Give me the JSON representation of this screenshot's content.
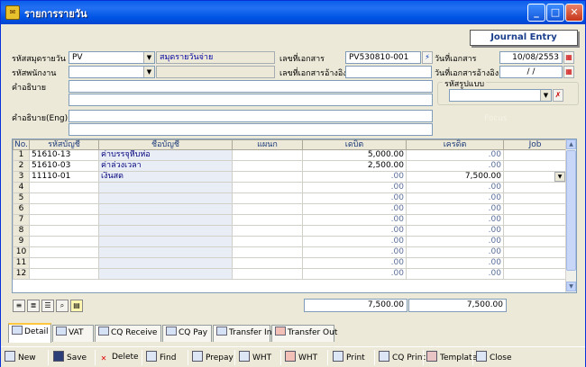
{
  "window": {
    "title": "รายการรายวัน",
    "icon": "app-icon"
  },
  "header": {
    "journal_entry": "Journal Entry",
    "journal_code_label": "รหัสสมุดรายวัน",
    "journal_code_value": "PV",
    "journal_name_value": "สมุดรายวันจ่าย",
    "doc_no_label": "เลขที่เอกสาร",
    "doc_no_value": "PV530810-001",
    "doc_date_label": "วันที่เอกสาร",
    "doc_date_value": "10/08/2553",
    "employee_label": "รหัสพนักงาน",
    "ref_doc_label": "เลขที่เอกสารอ้างอิง",
    "ref_date_label": "วันที่เอกสารอ้างอิง",
    "ref_date_value": " / /",
    "desc_label": "คำอธิบาย",
    "desc_eng_label": "คำอธิบาย(Eng)",
    "form_code_label": "รหัสรูปแบบ",
    "ghost_text": "Focus"
  },
  "grid": {
    "columns": [
      "No.",
      "รหัสบัญชี",
      "ชื่อบัญชี",
      "แผนก",
      "เดบิต",
      "เครดิต",
      "Job"
    ],
    "rows": [
      {
        "no": "1",
        "code": "51610-13",
        "name": "ค่าบรรจุหีบห่อ",
        "dept": "",
        "debit": "5,000.00",
        "credit": ".00",
        "job": ""
      },
      {
        "no": "2",
        "code": "51610-03",
        "name": "ค่าล่วงเวลา",
        "dept": "",
        "debit": "2,500.00",
        "credit": ".00",
        "job": ""
      },
      {
        "no": "3",
        "code": "11110-01",
        "name": "เงินสด",
        "dept": "",
        "debit": ".00",
        "credit": "7,500.00",
        "job": ""
      },
      {
        "no": "4",
        "code": "",
        "name": "",
        "dept": "",
        "debit": ".00",
        "credit": ".00",
        "job": ""
      },
      {
        "no": "5",
        "code": "",
        "name": "",
        "dept": "",
        "debit": ".00",
        "credit": ".00",
        "job": ""
      },
      {
        "no": "6",
        "code": "",
        "name": "",
        "dept": "",
        "debit": ".00",
        "credit": ".00",
        "job": ""
      },
      {
        "no": "7",
        "code": "",
        "name": "",
        "dept": "",
        "debit": ".00",
        "credit": ".00",
        "job": ""
      },
      {
        "no": "8",
        "code": "",
        "name": "",
        "dept": "",
        "debit": ".00",
        "credit": ".00",
        "job": ""
      },
      {
        "no": "9",
        "code": "",
        "name": "",
        "dept": "",
        "debit": ".00",
        "credit": ".00",
        "job": ""
      },
      {
        "no": "10",
        "code": "",
        "name": "",
        "dept": "",
        "debit": ".00",
        "credit": ".00",
        "job": ""
      },
      {
        "no": "11",
        "code": "",
        "name": "",
        "dept": "",
        "debit": ".00",
        "credit": ".00",
        "job": ""
      },
      {
        "no": "12",
        "code": "",
        "name": "",
        "dept": "",
        "debit": ".00",
        "credit": ".00",
        "job": ""
      }
    ]
  },
  "totals": {
    "debit": "7,500.00",
    "credit": "7,500.00"
  },
  "tabs": [
    {
      "label": "Detail",
      "icon": "detail-icon"
    },
    {
      "label": "VAT",
      "icon": "vat-icon"
    },
    {
      "label": "CQ Receive",
      "icon": "cq-receive-icon"
    },
    {
      "label": "CQ Pay",
      "icon": "cq-pay-icon"
    },
    {
      "label": "Transfer In",
      "icon": "transfer-in-icon"
    },
    {
      "label": "Transfer Out",
      "icon": "transfer-out-icon"
    }
  ],
  "toolbar": [
    {
      "label": "New",
      "icon": "new-icon"
    },
    {
      "label": "Save",
      "icon": "save-icon"
    },
    {
      "label": "Delete",
      "icon": "delete-icon"
    },
    {
      "label": "Find",
      "icon": "find-icon"
    },
    {
      "label": "Prepay",
      "icon": "prepay-icon"
    },
    {
      "label": "WHT",
      "icon": "wht-icon"
    },
    {
      "label": "WHT",
      "icon": "wht-icon"
    },
    {
      "label": "Print",
      "icon": "print-icon"
    },
    {
      "label": "CQ Print",
      "icon": "cq-print-icon"
    },
    {
      "label": "Template",
      "icon": "template-icon"
    },
    {
      "label": "Close",
      "icon": "close-door-icon"
    }
  ],
  "colors": {
    "title_start": "#0A5FEA",
    "title_end": "#0245D1",
    "face": "#ECE9D8",
    "link_blue": "#00007B"
  }
}
